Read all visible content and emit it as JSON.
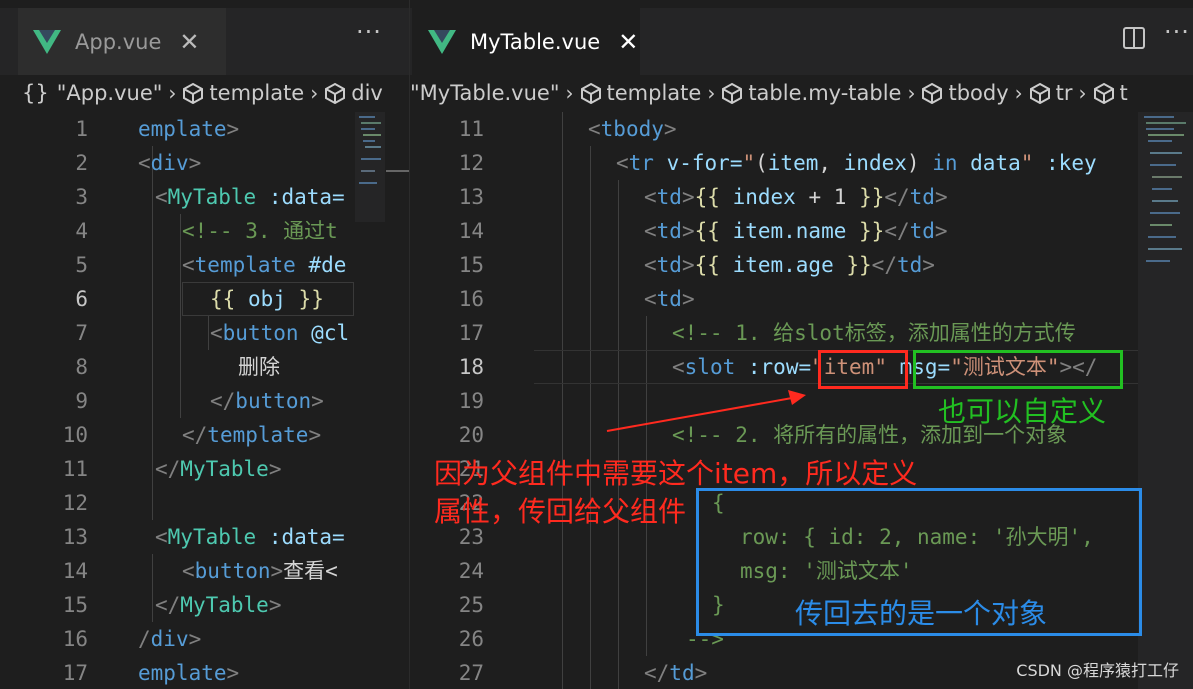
{
  "left_pane": {
    "tab_label": "App.vue",
    "more_label": "···",
    "breadcrumb": {
      "file": "\"App.vue\"",
      "template": "template",
      "div": "div"
    },
    "line_numbers": [
      "1",
      "2",
      "3",
      "4",
      "5",
      "6",
      "7",
      "8",
      "9",
      "10",
      "11",
      "12",
      "13",
      "14",
      "15",
      "16",
      "17"
    ],
    "current_line": "6"
  },
  "right_pane": {
    "tab_label": "MyTable.vue",
    "more_label": "···",
    "breadcrumb": {
      "file": "\"MyTable.vue\"",
      "template": "template",
      "table": "table.my-table",
      "tbody": "tbody",
      "tr": "tr",
      "t": "t"
    },
    "line_numbers": [
      "11",
      "12",
      "13",
      "14",
      "15",
      "16",
      "17",
      "18",
      "19",
      "20",
      "21",
      "22",
      "23",
      "24",
      "25",
      "26",
      "27"
    ],
    "current_line": "18"
  },
  "annotations": {
    "red_note_line1": "因为父组件中需要这个item，所以定义",
    "red_note_line2": "属性，传回给父组件",
    "green_note": "也可以自定义",
    "blue_note": "传回去的是一个对象",
    "red_color": "#ff2a1f",
    "green_color": "#22c022",
    "blue_color": "#2b8ce8"
  },
  "watermark": "CSDN @程序猿打工仔",
  "icons": [
    "vue-logo-icon",
    "close-icon",
    "more-actions-icon",
    "split-editor-icon",
    "braces-icon",
    "cube-icon",
    "chevron-right-icon"
  ]
}
